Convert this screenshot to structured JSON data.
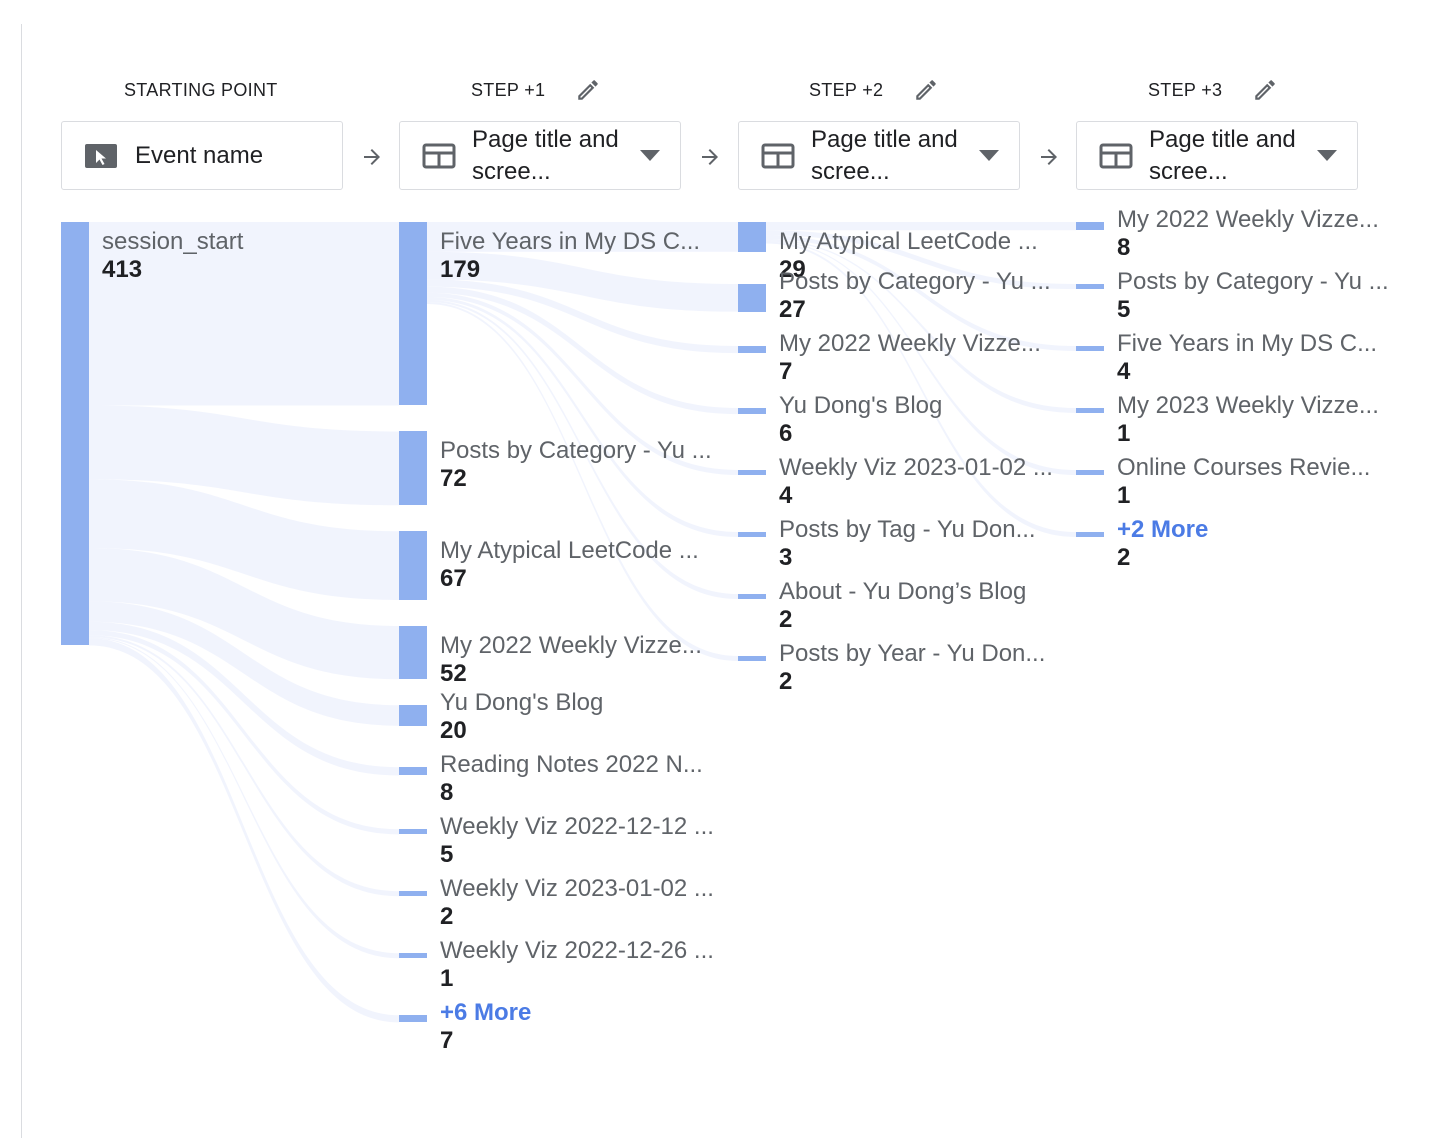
{
  "headers": {
    "starting_point": "STARTING POINT",
    "step1": "STEP +1",
    "step2": "STEP +2",
    "step3": "STEP +3"
  },
  "dimensions": {
    "start": "Event name",
    "step1": "Page title and scree...",
    "step2": "Page title and scree...",
    "step3": "Page title and scree..."
  },
  "icons": {
    "start": "cursor-click-icon",
    "steps": "table-layout-icon",
    "edit": "pencil-icon",
    "dropdown": "caret-down-icon",
    "next": "arrow-right-icon"
  },
  "colors": {
    "node": "#8fb0ef",
    "flow": "#e8edfb",
    "more_link": "#4b7be5"
  },
  "start_node": {
    "label": "session_start",
    "value": "413"
  },
  "step1_nodes": [
    {
      "label": "Five Years in My DS C...",
      "value": "179"
    },
    {
      "label": "Posts by Category - Yu ...",
      "value": "72"
    },
    {
      "label": "My Atypical LeetCode ...",
      "value": "67"
    },
    {
      "label": "My 2022 Weekly Vizze...",
      "value": "52"
    },
    {
      "label": "Yu Dong's Blog",
      "value": "20"
    },
    {
      "label": "Reading Notes 2022 N...",
      "value": "8"
    },
    {
      "label": "Weekly Viz 2022-12-12 ...",
      "value": "5"
    },
    {
      "label": "Weekly Viz 2023-01-02 ...",
      "value": "2"
    },
    {
      "label": "Weekly Viz 2022-12-26 ...",
      "value": "1"
    },
    {
      "label": "+6 More",
      "value": "7"
    }
  ],
  "step2_nodes": [
    {
      "label": "My Atypical LeetCode ...",
      "value": "29"
    },
    {
      "label": "Posts by Category - Yu ...",
      "value": "27"
    },
    {
      "label": "My 2022 Weekly Vizze...",
      "value": "7"
    },
    {
      "label": "Yu Dong's Blog",
      "value": "6"
    },
    {
      "label": "Weekly Viz 2023-01-02 ...",
      "value": "4"
    },
    {
      "label": "Posts by Tag - Yu Don...",
      "value": "3"
    },
    {
      "label": "About - Yu Dong’s Blog",
      "value": "2"
    },
    {
      "label": "Posts by Year - Yu Don...",
      "value": "2"
    }
  ],
  "step3_nodes": [
    {
      "label": "My 2022 Weekly Vizze...",
      "value": "8"
    },
    {
      "label": "Posts by Category - Yu ...",
      "value": "5"
    },
    {
      "label": "Five Years in My DS C...",
      "value": "4"
    },
    {
      "label": "My 2023 Weekly Vizze...",
      "value": "1"
    },
    {
      "label": "Online Courses Revie...",
      "value": "1"
    },
    {
      "label": "+2 More",
      "value": "2"
    }
  ]
}
